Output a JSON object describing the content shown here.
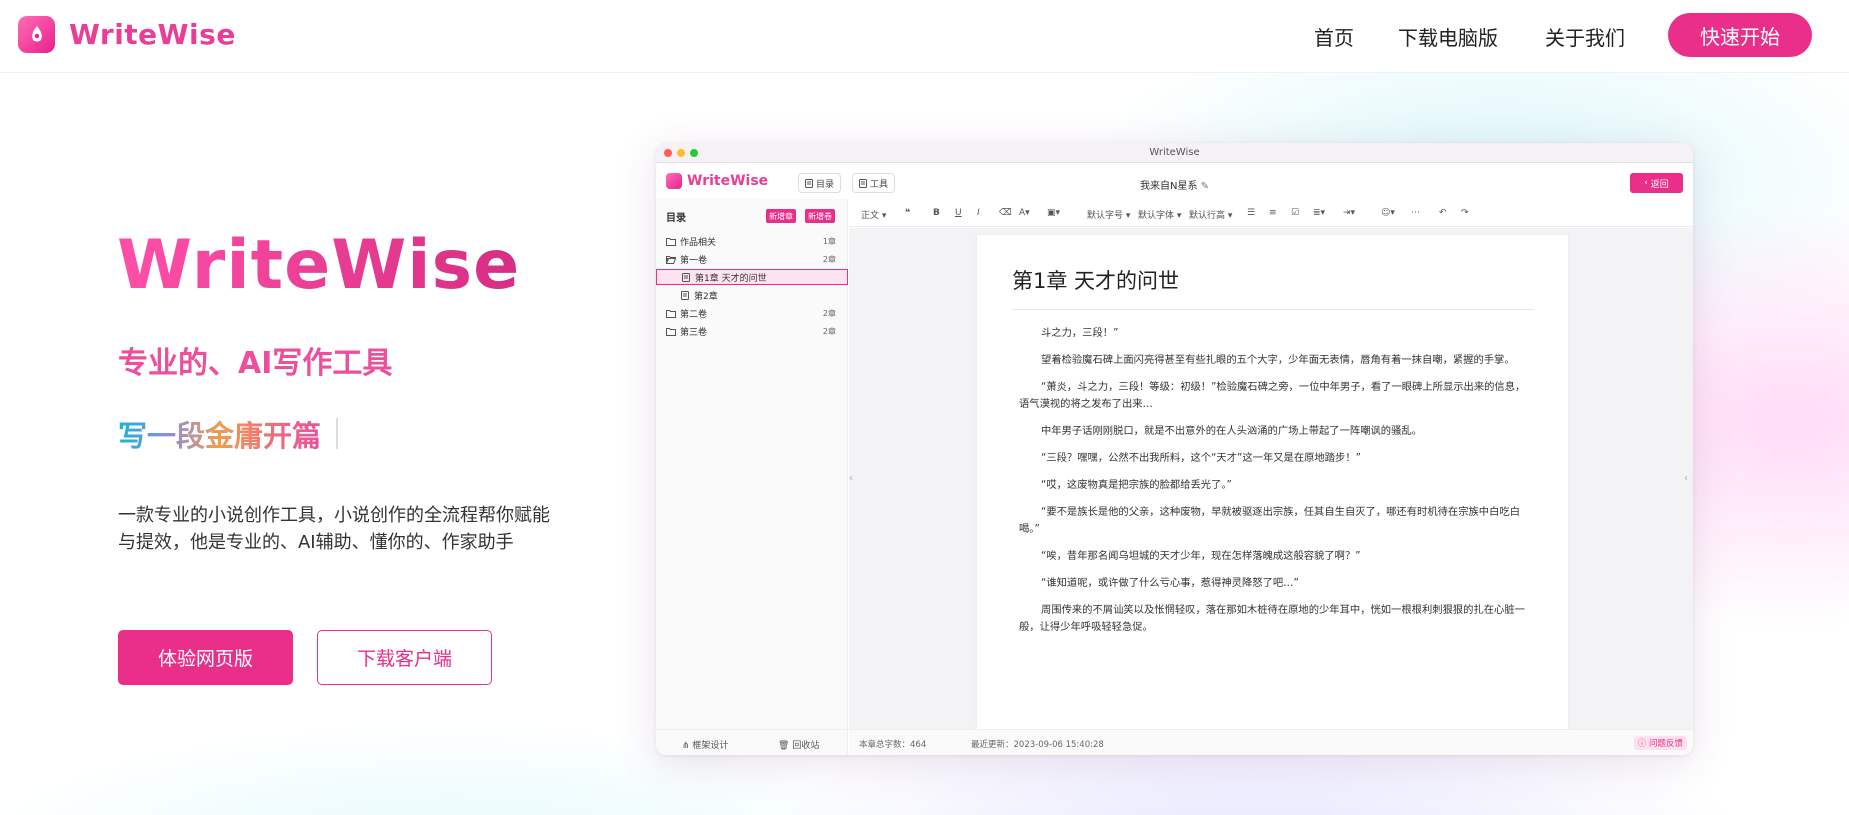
{
  "brand": {
    "name": "WriteWise",
    "accent": "#ea2f8b"
  },
  "nav": {
    "items": [
      "首页",
      "下载电脑版",
      "关于我们"
    ],
    "cta": "快速开始"
  },
  "hero": {
    "title": "WriteWise",
    "subtitle": "专业的、AI写作工具",
    "typing": "写一段金庸开篇",
    "description": "一款专业的小说创作工具，小说创作的全流程帮你赋能与提效，他是专业的、AI辅助、懂你的、作家助手",
    "primary_button": "体验网页版",
    "secondary_button": "下载客户端"
  },
  "app": {
    "window_title": "WriteWise",
    "logo_text": "WriteWise",
    "tabs": [
      "目录",
      "工具"
    ],
    "doc_title": "我来自N星系",
    "back_label": "返回",
    "sidebar": {
      "title": "目录",
      "new_chapter": "新增章",
      "new_volume": "新增卷",
      "tree": [
        {
          "label": "作品相关",
          "count": "1章",
          "level": 0,
          "icon": "folder-icon"
        },
        {
          "label": "第一卷",
          "count": "2章",
          "level": 0,
          "icon": "folder-open-icon"
        },
        {
          "label": "第1章 天才的问世",
          "count": "",
          "level": 1,
          "icon": "file-icon",
          "active": true
        },
        {
          "label": "第2章",
          "count": "",
          "level": 1,
          "icon": "file-icon"
        },
        {
          "label": "第二卷",
          "count": "2章",
          "level": 0,
          "icon": "folder-icon"
        },
        {
          "label": "第三卷",
          "count": "2章",
          "level": 0,
          "icon": "folder-icon"
        }
      ],
      "footer": {
        "framework": "框架设计",
        "trash": "回收站"
      }
    },
    "toolbar": {
      "style": "正文",
      "font_size": "默认字号",
      "font_family": "默认字体",
      "line_height": "默认行高"
    },
    "chapter": {
      "title": "第1章  天才的问世",
      "paragraphs": [
        "斗之力，三段！”",
        "望着检验魔石碑上面闪亮得甚至有些扎眼的五个大字，少年面无表情，唇角有着一抹自嘲，紧握的手掌。",
        "“萧炎，斗之力，三段！等级：初级！”检验魔石碑之旁，一位中年男子，看了一眼碑上所显示出来的信息，语气漠视的将之发布了出来…",
        "中年男子话刚刚脱口，就是不出意外的在人头汹涌的广场上带起了一阵嘲讽的骚乱。",
        "“三段？嘿嘿，公然不出我所料，这个“天才”这一年又是在原地踏步！”",
        "“哎，这废物真是把宗族的脸都给丢光了。”",
        "“要不是族长是他的父亲，这种废物，早就被驱逐出宗族，任其自生自灭了，哪还有时机待在宗族中白吃白喝。”",
        "“唉，昔年那名闻乌坦城的天才少年，现在怎样落魄成这般容貌了啊？”",
        "“谁知道呢，或许做了什么亏心事，惹得神灵降怒了吧…”",
        "周围传来的不屑讪笑以及怅惘轻叹，落在那如木桩待在原地的少年耳中，恍如一根根利刺狠狠的扎在心脏一般，让得少年呼吸轻轻急促。"
      ]
    },
    "status": {
      "word_count": "本章总字数：464",
      "updated": "最近更新：2023-09-06 15:40:28",
      "feedback": "问题反馈"
    }
  }
}
